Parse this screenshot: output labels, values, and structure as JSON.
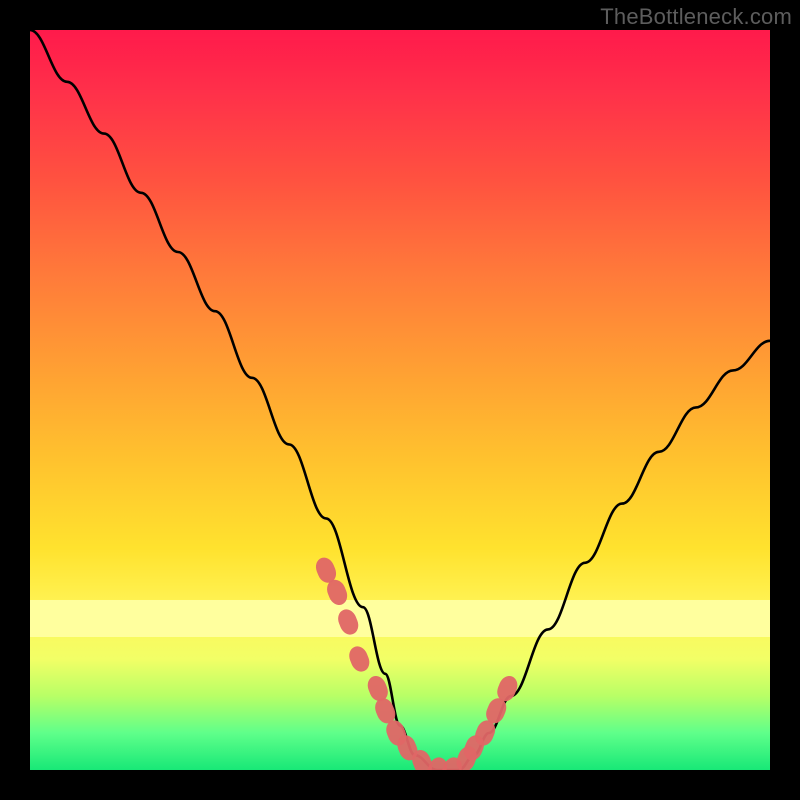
{
  "watermark": "TheBottleneck.com",
  "colors": {
    "frame": "#000000",
    "gradient_top": "#ff1a4b",
    "gradient_bottom": "#18e877",
    "marker": "#e06666",
    "curve": "#000000"
  },
  "chart_data": {
    "type": "line",
    "title": "",
    "xlabel": "",
    "ylabel": "",
    "xlim": [
      0,
      100
    ],
    "ylim": [
      0,
      100
    ],
    "series": [
      {
        "name": "bottleneck-curve",
        "x": [
          0,
          5,
          10,
          15,
          20,
          25,
          30,
          35,
          40,
          45,
          48,
          50,
          52,
          55,
          58,
          60,
          62,
          65,
          70,
          75,
          80,
          85,
          90,
          95,
          100
        ],
        "values": [
          100,
          93,
          86,
          78,
          70,
          62,
          53,
          44,
          34,
          22,
          13,
          6,
          2,
          0,
          0,
          2,
          5,
          10,
          19,
          28,
          36,
          43,
          49,
          54,
          58
        ]
      }
    ],
    "markers": {
      "name": "highlighted-points",
      "x": [
        40,
        41.5,
        43,
        44.5,
        47,
        48,
        49.5,
        51,
        53,
        55,
        57,
        59,
        60,
        61.5,
        63,
        64.5
      ],
      "values": [
        27,
        24,
        20,
        15,
        11,
        8,
        5,
        3,
        1,
        0,
        0,
        1.5,
        3,
        5,
        8,
        11
      ]
    },
    "bands": [
      {
        "name": "pale-yellow-band",
        "y0": 18,
        "y1": 23,
        "color": "#ffff9e"
      }
    ]
  }
}
